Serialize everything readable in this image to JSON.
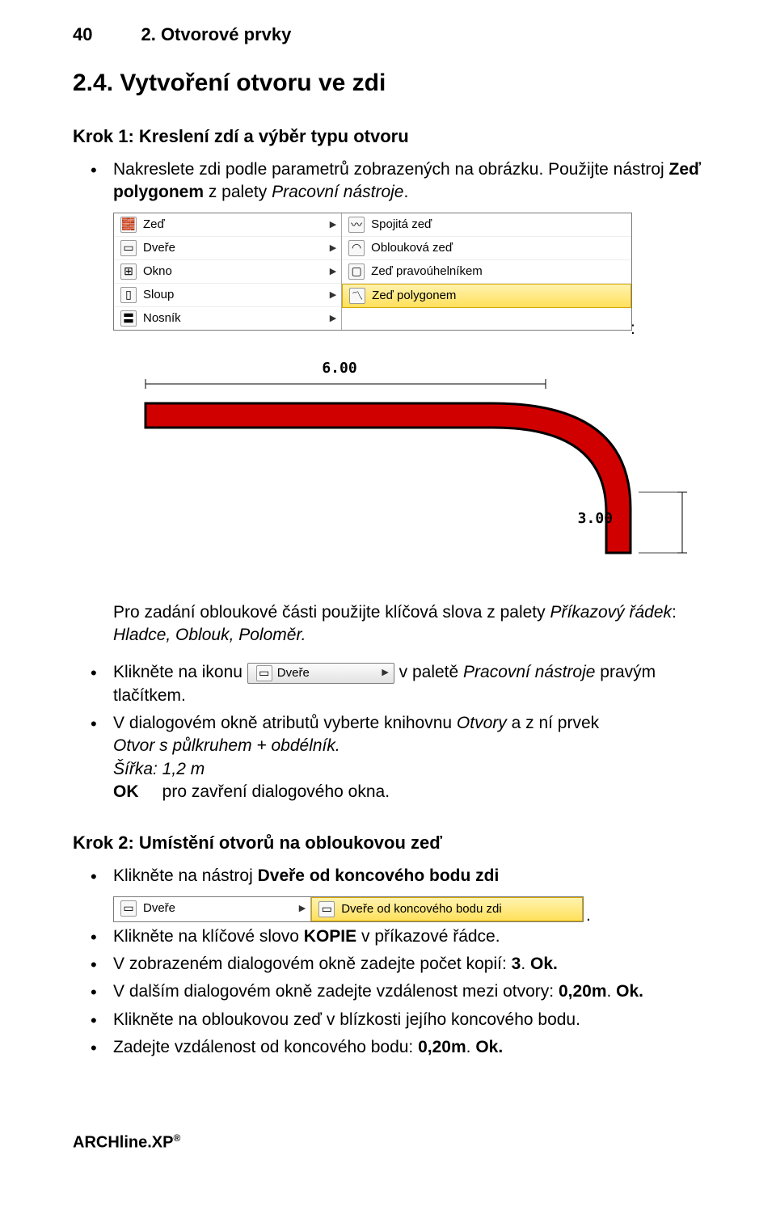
{
  "header": {
    "page_number": "40",
    "chapter": "2. Otvorové prvky"
  },
  "title": "2.4. Vytvoření otvoru ve zdi",
  "step1": {
    "heading": "Krok 1: Kreslení zdí a výběr typu otvoru",
    "bullets": {
      "b1_a": "Nakreslete zdi podle parametrů zobrazených na obrázku. Použijte nástroj ",
      "b1_b": "Zeď polygonem",
      "b1_c": " z palety ",
      "b1_d": "Pracovní nástroje",
      "b1_e": "."
    },
    "menu": {
      "left": [
        "Zeď",
        "Dveře",
        "Okno",
        "Sloup",
        "Nosník"
      ],
      "right": [
        "Spojitá zeď",
        "Oblouková zeď",
        "Zeď pravoúhelníkem",
        "Zeď polygonem"
      ]
    },
    "colon": ":",
    "diagram": {
      "top_dim": "6.00",
      "right_dim": "3.00"
    },
    "after_diagram": {
      "p1_a": "Pro zadání obloukové části použijte klíčová slova z palety ",
      "p1_b": "Příkazový řádek",
      "p1_c": ": ",
      "p1_d": "Hladce, Oblouk, Poloměr.",
      "b2_a": "Klikněte na ikonu ",
      "b2_b": " v paletě ",
      "b2_c": "Pracovní nástroje",
      "b2_d": " pravým tlačítkem.",
      "dvere_btn": "Dveře",
      "b3_a": "V dialogovém okně atributů vyberte knihovnu ",
      "b3_b": "Otvory",
      "b3_c": " a z ní prvek ",
      "b3_d": "Otvor s půlkruhem + obdélník.",
      "line_width": "Šířka: 1,2 m",
      "line_ok_a": "OK",
      "line_ok_b": "     pro zavření dialogového okna."
    }
  },
  "step2": {
    "heading": "Krok 2: Umístění otvorů na obloukovou zeď",
    "bullets": {
      "b1_a": "Klikněte na nástroj ",
      "b1_b": "Dveře od koncového bodu zdi"
    },
    "menu2": {
      "left": [
        "Dveře"
      ],
      "right": [
        "Dveře od koncového bodu zdi"
      ]
    },
    "period": ".",
    "rest": {
      "b2_a": "Klikněte na klíčové slovo ",
      "b2_b": "KOPIE",
      "b2_c": " v příkazové řádce.",
      "b3_a": "V zobrazeném dialogovém okně zadejte počet kopií: ",
      "b3_b": "3",
      "b3_c": ". ",
      "b3_d": "Ok.",
      "b4_a": "V dalším dialogovém okně zadejte vzdálenost mezi otvory: ",
      "b4_b": "0,20m",
      "b4_c": ". ",
      "b4_d": "Ok.",
      "b5": "Klikněte na obloukovou zeď v blízkosti jejího koncového bodu.",
      "b6_a": "Zadejte vzdálenost od koncového bodu: ",
      "b6_b": "0,20m",
      "b6_c": ". ",
      "b6_d": "Ok."
    }
  },
  "footer": {
    "product": "ARCHline.XP",
    "reg": "®"
  },
  "icons": {
    "wall": "🧱",
    "door": "▭",
    "window": "⊞",
    "column": "▯",
    "beam": "〓",
    "line": "〰",
    "arc": "◠",
    "rect": "▢",
    "poly": "〽",
    "door2": "▭"
  }
}
